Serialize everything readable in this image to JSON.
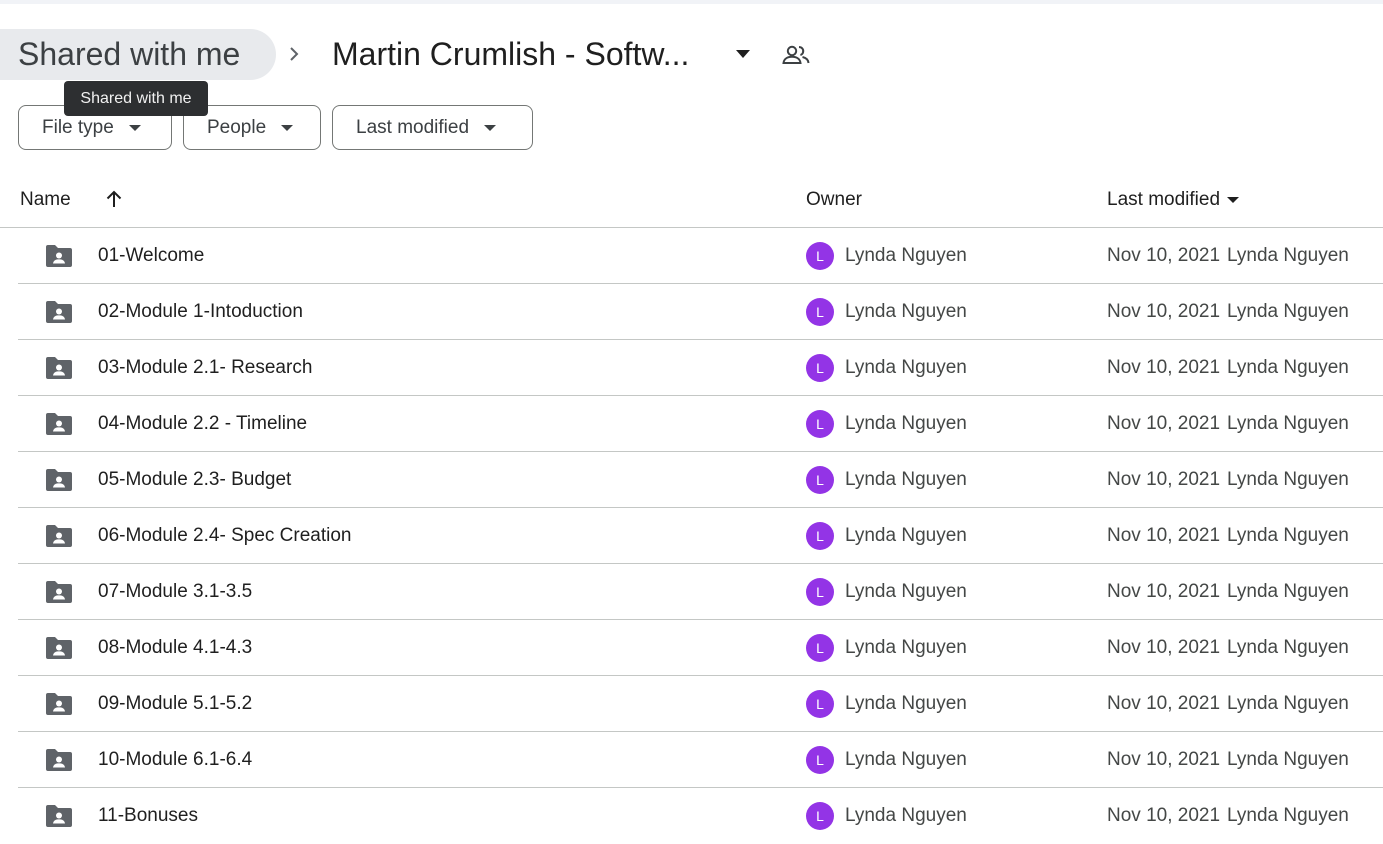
{
  "breadcrumb": {
    "root": "Shared with me",
    "current": "Martin Crumlish - Softw..."
  },
  "tooltip": "Shared with me",
  "filters": {
    "file_type": "File type",
    "people": "People",
    "last_modified": "Last modified"
  },
  "table": {
    "headers": {
      "name": "Name",
      "owner": "Owner",
      "last_modified": "Last modified"
    },
    "sort": "ascending",
    "rows": [
      {
        "name": "01-Welcome",
        "owner_initial": "L",
        "owner": "Lynda Nguyen",
        "date": "Nov 10, 2021",
        "modified_by": "Lynda Nguyen"
      },
      {
        "name": "02-Module 1-Intoduction",
        "owner_initial": "L",
        "owner": "Lynda Nguyen",
        "date": "Nov 10, 2021",
        "modified_by": "Lynda Nguyen"
      },
      {
        "name": "03-Module 2.1- Research",
        "owner_initial": "L",
        "owner": "Lynda Nguyen",
        "date": "Nov 10, 2021",
        "modified_by": "Lynda Nguyen"
      },
      {
        "name": "04-Module 2.2 - Timeline",
        "owner_initial": "L",
        "owner": "Lynda Nguyen",
        "date": "Nov 10, 2021",
        "modified_by": "Lynda Nguyen"
      },
      {
        "name": "05-Module 2.3- Budget",
        "owner_initial": "L",
        "owner": "Lynda Nguyen",
        "date": "Nov 10, 2021",
        "modified_by": "Lynda Nguyen"
      },
      {
        "name": "06-Module 2.4- Spec Creation",
        "owner_initial": "L",
        "owner": "Lynda Nguyen",
        "date": "Nov 10, 2021",
        "modified_by": "Lynda Nguyen"
      },
      {
        "name": "07-Module 3.1-3.5",
        "owner_initial": "L",
        "owner": "Lynda Nguyen",
        "date": "Nov 10, 2021",
        "modified_by": "Lynda Nguyen"
      },
      {
        "name": "08-Module 4.1-4.3",
        "owner_initial": "L",
        "owner": "Lynda Nguyen",
        "date": "Nov 10, 2021",
        "modified_by": "Lynda Nguyen"
      },
      {
        "name": "09-Module 5.1-5.2",
        "owner_initial": "L",
        "owner": "Lynda Nguyen",
        "date": "Nov 10, 2021",
        "modified_by": "Lynda Nguyen"
      },
      {
        "name": "10-Module 6.1-6.4",
        "owner_initial": "L",
        "owner": "Lynda Nguyen",
        "date": "Nov 10, 2021",
        "modified_by": "Lynda Nguyen"
      },
      {
        "name": "11-Bonuses",
        "owner_initial": "L",
        "owner": "Lynda Nguyen",
        "date": "Nov 10, 2021",
        "modified_by": "Lynda Nguyen"
      }
    ]
  },
  "icons": {
    "folder": "shared-folder-icon",
    "people": "people-icon",
    "sort": "arrow-up-icon",
    "dropdown": "caret-down-icon",
    "breadcrumb_separator": "chevron-right-icon"
  },
  "colors": {
    "avatar": "#9334e6",
    "folder": "#5f6368",
    "tooltip_bg": "#2d2f31"
  }
}
